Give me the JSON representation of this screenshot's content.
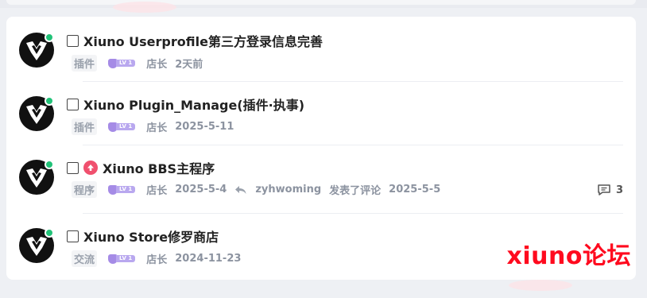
{
  "threads": [
    {
      "title": "Xiuno Userprofile第三方登录信息完善",
      "is_top": false,
      "category": "插件",
      "level": "LV 1",
      "author": "店长",
      "date": "2天前",
      "reply_user": "",
      "reply_action": "",
      "reply_date": "",
      "comments": ""
    },
    {
      "title": "Xiuno Plugin_Manage(插件·执事)",
      "is_top": false,
      "category": "插件",
      "level": "LV 1",
      "author": "店长",
      "date": "2025-5-11",
      "reply_user": "",
      "reply_action": "",
      "reply_date": "",
      "comments": ""
    },
    {
      "title": "Xiuno BBS主程序",
      "is_top": true,
      "category": "程序",
      "level": "LV 1",
      "author": "店长",
      "date": "2025-5-4",
      "reply_user": "zyhwoming",
      "reply_action": "发表了评论",
      "reply_date": "2025-5-5",
      "comments": "3"
    },
    {
      "title": "Xiuno Store修罗商店",
      "is_top": false,
      "category": "交流",
      "level": "LV 1",
      "author": "店长",
      "date": "2024-11-23",
      "reply_user": "",
      "reply_action": "",
      "reply_date": "",
      "comments": ""
    }
  ],
  "watermark": "xiuno论坛",
  "colors": {
    "accent_top": "#f0506e",
    "online": "#21c278",
    "level": "#a58be6",
    "watermark": "#ff0a1e"
  },
  "icons": [
    "avatar-logo-icon",
    "checkbox-icon",
    "top-arrow-icon",
    "level-badge-icon",
    "reply-arrow-icon",
    "comment-icon"
  ]
}
